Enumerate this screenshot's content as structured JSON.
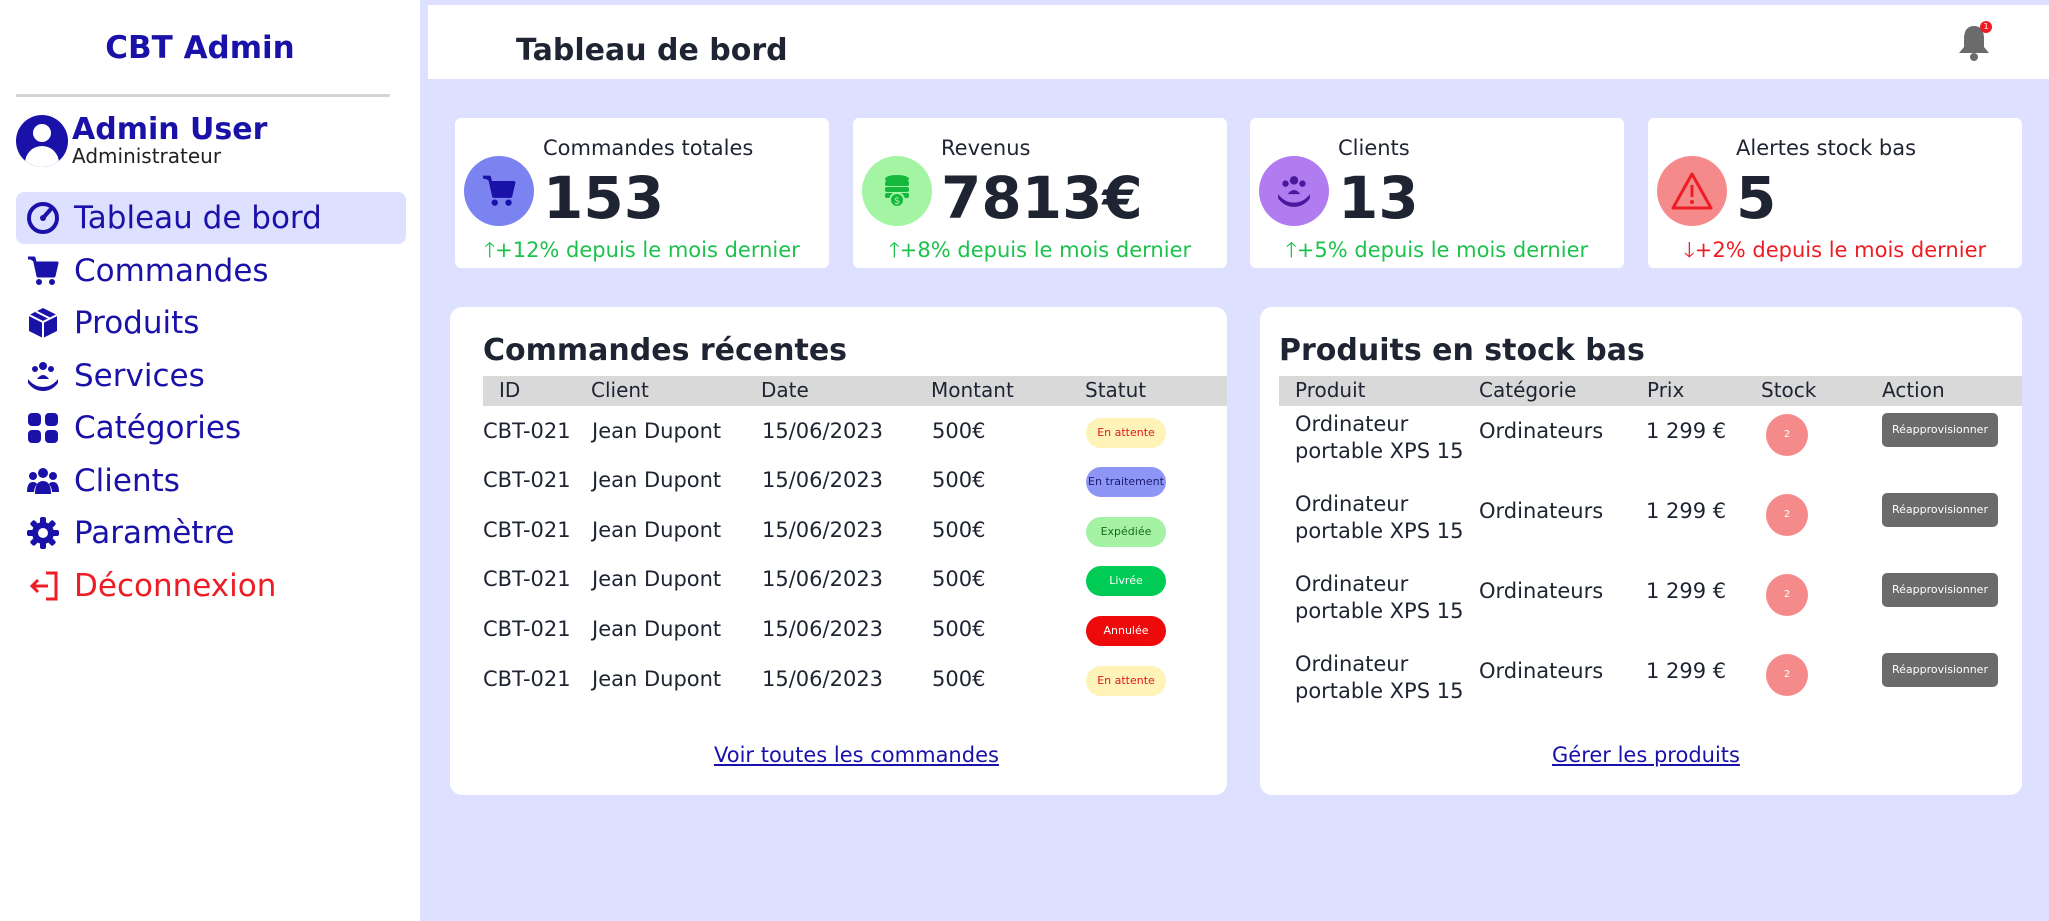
{
  "sidebar": {
    "brand": "CBT Admin",
    "user": {
      "name": "Admin User",
      "role": "Administrateur"
    },
    "items": [
      {
        "label": "Tableau de bord",
        "icon": "dashboard-icon",
        "active": true
      },
      {
        "label": "Commandes",
        "icon": "cart-icon"
      },
      {
        "label": "Produits",
        "icon": "box-icon"
      },
      {
        "label": "Services",
        "icon": "hands-people-icon"
      },
      {
        "label": "Catégories",
        "icon": "grid-icon"
      },
      {
        "label": "Clients",
        "icon": "users-icon"
      },
      {
        "label": "Paramètre",
        "icon": "gear-icon"
      },
      {
        "label": "Déconnexion",
        "icon": "logout-icon"
      }
    ]
  },
  "header": {
    "title": "Tableau de bord",
    "notification_count": "1"
  },
  "stats": [
    {
      "label": "Commandes totales",
      "value": "153",
      "trend": "+12% depuis le mois dernier",
      "direction": "up",
      "icon": "cart-icon",
      "color": "#7b83f0"
    },
    {
      "label": "Revenus",
      "value": "7813€",
      "trend": "+8% depuis le mois dernier",
      "direction": "up",
      "icon": "money-icon",
      "color": "#a3f5a3"
    },
    {
      "label": "Clients",
      "value": "13",
      "trend": "+5% depuis le mois dernier",
      "direction": "up",
      "icon": "hands-people-icon",
      "color": "#b07cf0"
    },
    {
      "label": "Alertes stock bas",
      "value": "5",
      "trend": "+2% depuis le mois dernier",
      "direction": "down",
      "icon": "warning-icon",
      "color": "#f58a8a"
    }
  ],
  "orders": {
    "title": "Commandes récentes",
    "columns": [
      "ID",
      "Client",
      "Date",
      "Montant",
      "Statut"
    ],
    "rows": [
      {
        "id": "CBT-021",
        "client": "Jean Dupont",
        "date": "15/06/2023",
        "amount": "500€",
        "status": "En attente"
      },
      {
        "id": "CBT-021",
        "client": "Jean Dupont",
        "date": "15/06/2023",
        "amount": "500€",
        "status": "En traitement"
      },
      {
        "id": "CBT-021",
        "client": "Jean Dupont",
        "date": "15/06/2023",
        "amount": "500€",
        "status": "Expédiée"
      },
      {
        "id": "CBT-021",
        "client": "Jean Dupont",
        "date": "15/06/2023",
        "amount": "500€",
        "status": "Livrée"
      },
      {
        "id": "CBT-021",
        "client": "Jean Dupont",
        "date": "15/06/2023",
        "amount": "500€",
        "status": "Annulée"
      },
      {
        "id": "CBT-021",
        "client": "Jean Dupont",
        "date": "15/06/2023",
        "amount": "500€",
        "status": "En attente"
      }
    ],
    "status_colors": {
      "En attente": {
        "bg": "#fff3b8",
        "fg": "#d91c1c"
      },
      "En traitement": {
        "bg": "#8e96f5",
        "fg": "#1a1a6e"
      },
      "Expédiée": {
        "bg": "#a5f2a5",
        "fg": "#146b14"
      },
      "Livrée": {
        "bg": "#00cc55",
        "fg": "#ffffff"
      },
      "Annulée": {
        "bg": "#ee0a0a",
        "fg": "#ffffff"
      }
    },
    "link": "Voir toutes les commandes"
  },
  "low_stock": {
    "title": "Produits en stock bas",
    "columns": [
      "Produit",
      "Catégorie",
      "Prix",
      "Stock",
      "Action"
    ],
    "rows": [
      {
        "name": "Ordinateur portable XPS 15",
        "category": "Ordinateurs",
        "price": "1 299 €",
        "stock": "2",
        "action": "Réapprovisionner"
      },
      {
        "name": "Ordinateur portable XPS 15",
        "category": "Ordinateurs",
        "price": "1 299 €",
        "stock": "2",
        "action": "Réapprovisionner"
      },
      {
        "name": "Ordinateur portable XPS 15",
        "category": "Ordinateurs",
        "price": "1 299 €",
        "stock": "2",
        "action": "Réapprovisionner"
      },
      {
        "name": "Ordinateur portable XPS 15",
        "category": "Ordinateurs",
        "price": "1 299 €",
        "stock": "2",
        "action": "Réapprovisionner"
      }
    ],
    "link": "Gérer les produits"
  }
}
